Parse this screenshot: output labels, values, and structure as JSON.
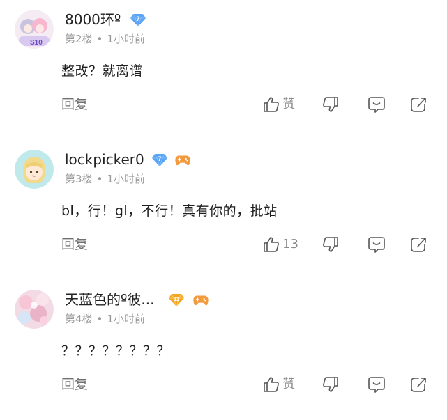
{
  "icons": {
    "level": "diamond-level-icon",
    "game": "gamepad-icon",
    "like": "thumbs-up-icon",
    "dislike": "thumbs-down-icon",
    "comment": "comment-bubble-icon",
    "share": "share-arrow-icon"
  },
  "colors": {
    "badge_blue": "#5aa3f5",
    "badge_gold": "#f5a623",
    "game_orange": "#f39a3e",
    "meta_gray": "#9a9a9a",
    "action_gray": "#8a8a8a"
  },
  "comments": [
    {
      "username": "8000环º",
      "level": "7",
      "floor": "第2楼",
      "dot": "•",
      "time": "1小时前",
      "text": "整改？就离谱",
      "reply_label": "回复",
      "like_label": "赞"
    },
    {
      "username": "lockpicker0",
      "level": "7",
      "floor": "第3楼",
      "dot": "•",
      "time": "1小时前",
      "text": "bl，行！gl，不行！真有你的，批站",
      "reply_label": "回复",
      "like_label": "13"
    },
    {
      "username": "天蓝色的º彼...",
      "level": "11",
      "floor": "第4楼",
      "dot": "•",
      "time": "1小时前",
      "text": "？？？？？？？？",
      "reply_label": "回复",
      "like_label": "赞"
    }
  ]
}
